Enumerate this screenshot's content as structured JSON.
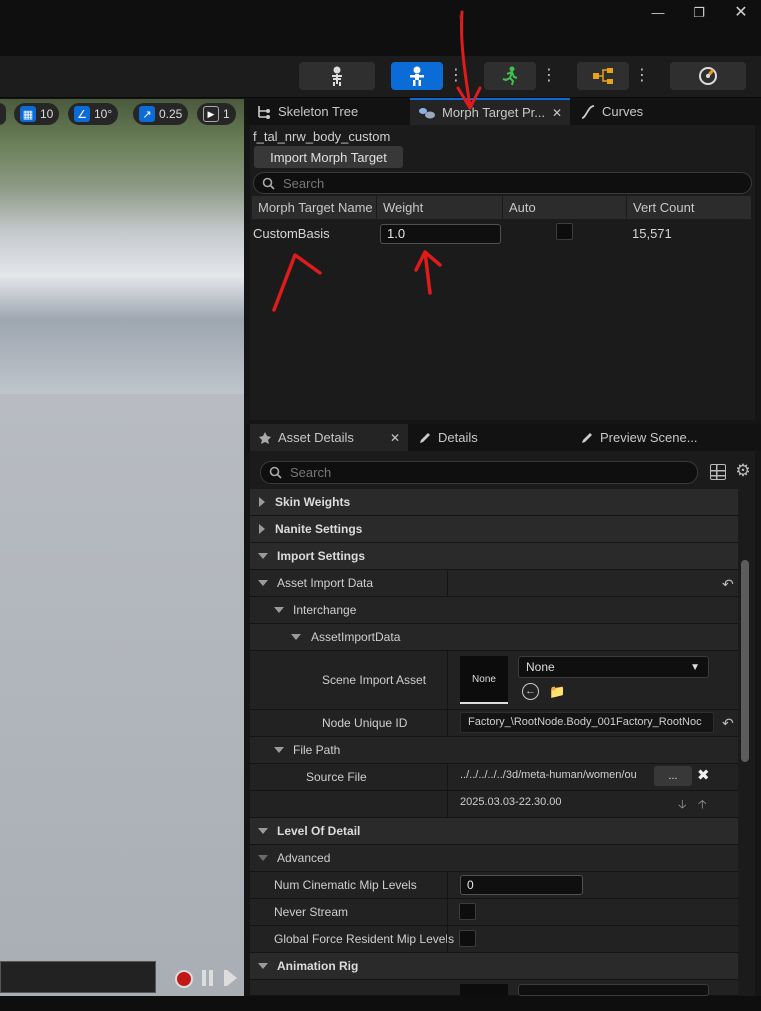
{
  "window": {
    "minimize_icon": "minimize-icon",
    "maximize_icon": "maximize-icon",
    "close_icon": "close-icon"
  },
  "toolbar": {
    "buttons": [
      "skeleton-icon",
      "mesh-icon",
      "animation-icon",
      "blueprint-icon",
      "physics-icon"
    ]
  },
  "viewport": {
    "grid_value": "10",
    "angle_value": "10°",
    "scale_value": "0.25",
    "camera_value": "1"
  },
  "tabs": {
    "skeleton_tree": "Skeleton Tree",
    "morph_target": "Morph Target Pr...",
    "curves": "Curves"
  },
  "morph": {
    "asset_name": "f_tal_nrw_body_custom",
    "import_button": "Import Morph Target",
    "search_placeholder": "Search",
    "columns": [
      "Morph Target Name",
      "Weight",
      "Auto",
      "Vert Count"
    ],
    "rows": [
      {
        "name": "CustomBasis",
        "weight": "1.0",
        "auto": false,
        "vert_count": "15,571"
      }
    ]
  },
  "details_tabs": {
    "asset_details": "Asset Details",
    "details": "Details",
    "preview": "Preview Scene..."
  },
  "details": {
    "search_placeholder": "Search",
    "skin_weights": "Skin Weights",
    "nanite_settings": "Nanite Settings",
    "import_settings": "Import Settings",
    "asset_import_data": "Asset Import Data",
    "interchange": "Interchange",
    "asset_import_data_sub": "AssetImportData",
    "scene_import_asset": "Scene Import Asset",
    "scene_thumb": "None",
    "scene_dropdown": "None",
    "node_unique_id": "Node Unique ID",
    "node_unique_id_value": "Factory_\\RootNode.Body_001Factory_RootNoc",
    "file_path": "File Path",
    "source_file": "Source File",
    "source_file_value": "../../../../../3d/meta-human/women/ou",
    "browse_label": "...",
    "timestamp": "2025.03.03-22.30.00",
    "level_of_detail": "Level Of Detail",
    "advanced": "Advanced",
    "num_cinematic_mip": "Num Cinematic Mip Levels",
    "num_cinematic_mip_value": "0",
    "never_stream": "Never Stream",
    "global_force": "Global Force Resident Mip Levels",
    "animation_rig": "Animation Rig"
  },
  "colors": {
    "accent": "#0b6cd8",
    "annotation": "#e01b1b"
  }
}
